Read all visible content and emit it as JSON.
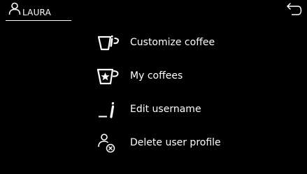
{
  "header": {
    "user_name": "LAURA"
  },
  "menu": {
    "items": [
      {
        "label": "Customize coffee",
        "icon": "cup-with-info-icon"
      },
      {
        "label": "My coffees",
        "icon": "cup-with-star-icon"
      },
      {
        "label": "Edit username",
        "icon": "edit-text-icon"
      },
      {
        "label": "Delete user profile",
        "icon": "delete-user-icon"
      }
    ]
  },
  "colors": {
    "background": "#000000",
    "foreground": "#ffffff"
  }
}
